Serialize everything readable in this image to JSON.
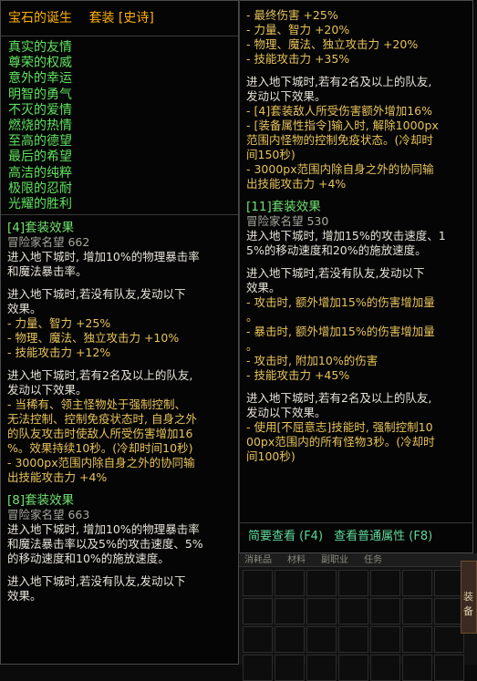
{
  "item": {
    "name": "宝石的诞生",
    "type": "套装",
    "rarity": "[史诗]"
  },
  "set_pieces": [
    "真实的友情",
    "尊荣的权威",
    "意外的幸运",
    "明智的勇气",
    "不灭的爱情",
    "燃烧的热情",
    "至高的德望",
    "最后的希望",
    "高洁的纯粹",
    "极限的忍耐",
    "光耀的胜利"
  ],
  "left_effects": [
    {
      "t": "hdr",
      "s": "[4]套装效果"
    },
    {
      "t": "gray",
      "s": "冒险家名望 662"
    },
    {
      "t": "white",
      "s": "进入地下城时, 增加10%的物理暴击率"
    },
    {
      "t": "white",
      "s": "和魔法暴击率。"
    },
    {
      "t": "gap"
    },
    {
      "t": "white",
      "s": "进入地下城时,若没有队友,发动以下"
    },
    {
      "t": "white",
      "s": "效果。"
    },
    {
      "t": "gold",
      "s": "- 力量、智力 +25%"
    },
    {
      "t": "gold",
      "s": "- 物理、魔法、独立攻击力 +10%"
    },
    {
      "t": "gold",
      "s": "- 技能攻击力 +12%"
    },
    {
      "t": "gap"
    },
    {
      "t": "white",
      "s": "进入地下城时,若有2名及以上的队友,"
    },
    {
      "t": "white",
      "s": "发动以下效果。"
    },
    {
      "t": "gold",
      "s": "- 当稀有、领主怪物处于强制控制、"
    },
    {
      "t": "gold",
      "s": "无法控制、控制免疫状态时, 自身之外"
    },
    {
      "t": "gold",
      "s": "的队友攻击时使敌人所受伤害增加16"
    },
    {
      "t": "gold",
      "s": "%。效果持续10秒。(冷却时间10秒)"
    },
    {
      "t": "gold",
      "s": "- 3000px范围内除自身之外的协同输"
    },
    {
      "t": "gold",
      "s": "出技能攻击力 +4%"
    },
    {
      "t": "gap"
    },
    {
      "t": "hdr",
      "s": "[8]套装效果"
    },
    {
      "t": "gray",
      "s": "冒险家名望 663"
    },
    {
      "t": "white",
      "s": "进入地下城时, 增加10%的物理暴击率"
    },
    {
      "t": "white",
      "s": "和魔法暴击率以及5%的攻击速度、5%"
    },
    {
      "t": "white",
      "s": "的移动速度和10%的施放速度。"
    },
    {
      "t": "gap"
    },
    {
      "t": "white",
      "s": "进入地下城时,若没有队友,发动以下"
    },
    {
      "t": "white",
      "s": "效果。"
    }
  ],
  "right_effects": [
    {
      "t": "gold",
      "s": "- 最终伤害 +25%"
    },
    {
      "t": "gold",
      "s": "- 力量、智力 +20%"
    },
    {
      "t": "gold",
      "s": "- 物理、魔法、独立攻击力 +20%"
    },
    {
      "t": "gold",
      "s": "- 技能攻击力 +35%"
    },
    {
      "t": "gap"
    },
    {
      "t": "white",
      "s": "进入地下城时,若有2名及以上的队友,"
    },
    {
      "t": "white",
      "s": "发动以下效果。"
    },
    {
      "t": "gold",
      "s": "- [4]套装敌人所受伤害额外增加16%"
    },
    {
      "t": "gold",
      "s": "- [装备属性指令]输入时, 解除1000px"
    },
    {
      "t": "gold",
      "s": "范围内怪物的控制免疫状态。(冷却时"
    },
    {
      "t": "gold",
      "s": "间150秒)"
    },
    {
      "t": "gold",
      "s": "- 3000px范围内除自身之外的协同输"
    },
    {
      "t": "gold",
      "s": "出技能攻击力 +4%"
    },
    {
      "t": "gap"
    },
    {
      "t": "hdr",
      "s": "[11]套装效果"
    },
    {
      "t": "gray",
      "s": "冒险家名望 530"
    },
    {
      "t": "white",
      "s": "进入地下城时, 增加15%的攻击速度、1"
    },
    {
      "t": "white",
      "s": "5%的移动速度和20%的施放速度。"
    },
    {
      "t": "gap"
    },
    {
      "t": "white",
      "s": "进入地下城时,若没有队友,发动以下"
    },
    {
      "t": "white",
      "s": "效果。"
    },
    {
      "t": "gold",
      "s": "- 攻击时, 额外增加15%的伤害增加量"
    },
    {
      "t": "gold",
      "s": "。"
    },
    {
      "t": "gold",
      "s": "- 暴击时, 额外增加15%的伤害增加量"
    },
    {
      "t": "gold",
      "s": "。"
    },
    {
      "t": "gold",
      "s": "- 攻击时, 附加10%的伤害"
    },
    {
      "t": "gold",
      "s": "- 技能攻击力 +45%"
    },
    {
      "t": "gap"
    },
    {
      "t": "white",
      "s": "进入地下城时,若有2名及以上的队友,"
    },
    {
      "t": "white",
      "s": "发动以下效果。"
    },
    {
      "t": "gold",
      "s": "- 使用[不屈意志]技能时, 强制控制10"
    },
    {
      "t": "gold",
      "s": "00px范围内的所有怪物3秒。(冷却时"
    },
    {
      "t": "gold",
      "s": "间100秒)"
    }
  ],
  "links": {
    "brief": "简要查看 (F4)",
    "normal": "查看普通属性 (F8)"
  },
  "background": {
    "tabs": [
      "消耗品",
      "材料",
      "副职业",
      "任务"
    ],
    "side_button": "装备"
  }
}
